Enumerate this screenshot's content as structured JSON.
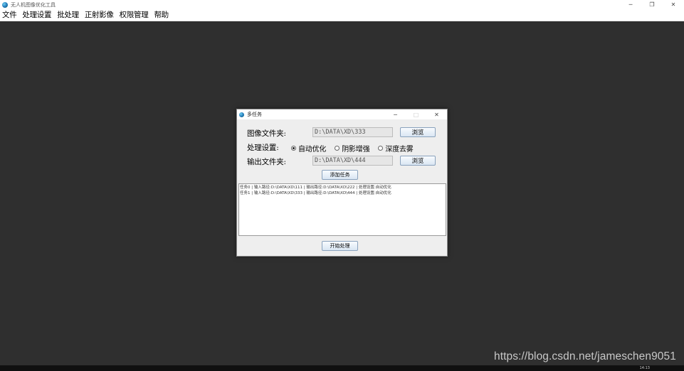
{
  "window": {
    "title": "无人机图像优化工具",
    "controls": [
      "─",
      "❐",
      "✕"
    ]
  },
  "menubar": {
    "items": [
      "文件",
      "处理设置",
      "批处理",
      "正射影像",
      "权限管理",
      "帮助"
    ]
  },
  "dialog": {
    "title": "多任务",
    "controls": [
      "─",
      "□",
      "✕"
    ],
    "image_folder": {
      "label": "图像文件夹:",
      "value": "D:\\DATA\\XD\\333",
      "browse_label": "浏览"
    },
    "settings": {
      "label": "处理设置:",
      "options": [
        {
          "label": "自动优化",
          "checked": true
        },
        {
          "label": "阴影增强",
          "checked": false
        },
        {
          "label": "深度去雾",
          "checked": false
        }
      ]
    },
    "output_folder": {
      "label": "输出文件夹:",
      "value": "D:\\DATA\\XD\\444",
      "browse_label": "浏览"
    },
    "add_task_label": "添加任务",
    "tasks": [
      "任务0 | 输入路径:D:\\DATA\\XD\\111 | 输出路径:D:\\DATA\\XD\\222 | 处理设置:自动优化",
      "任务1 | 输入路径:D:\\DATA\\XD\\333 | 输出路径:D:\\DATA\\XD\\444 | 处理设置:自动优化"
    ],
    "start_label": "开始处理"
  },
  "taskbar": {
    "clock": "14:13"
  },
  "watermark": "https://blog.csdn.net/jameschen9051"
}
